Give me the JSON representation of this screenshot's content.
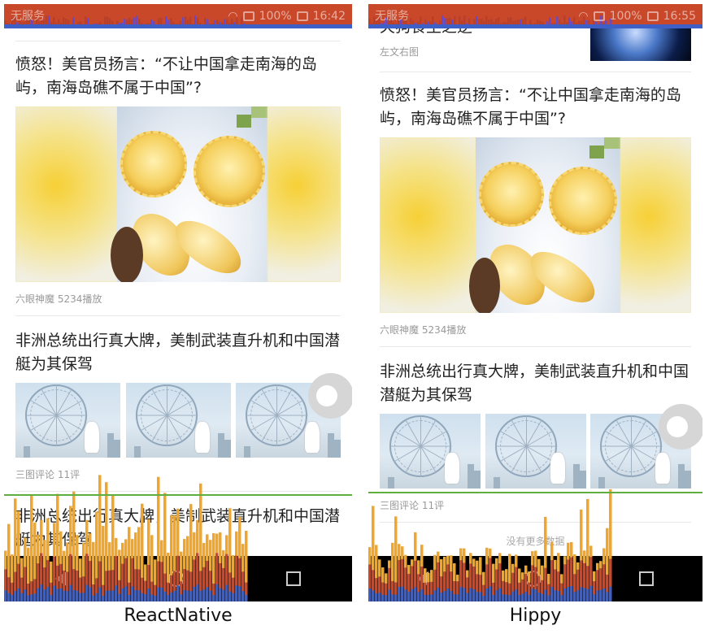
{
  "status_bar": {
    "react_native": {
      "carrier": "无服务",
      "battery": "100%",
      "time": "16:42"
    },
    "hippy": {
      "carrier": "无服务",
      "battery": "100%",
      "time": "16:55"
    }
  },
  "react_native": {
    "caption": "ReactNative",
    "items": [
      {
        "title": "愤怒！美官员扬言：“不让中国拿走南海的岛屿，南海岛礁不属于中国”?",
        "meta": "六眼神魔  5234播放"
      },
      {
        "title": "非洲总统出行真大牌，美制武装直升机和中国潜艇为其保驾",
        "meta": "三图评论 11评"
      },
      {
        "title": "非洲总统出行真大牌，美制武装直升机和中国潜艇为其保驾"
      }
    ]
  },
  "hippy": {
    "caption": "Hippy",
    "prev_meta": "左文右图",
    "prev_title_partial": "天狗食生之逆",
    "items": [
      {
        "title": "愤怒！美官员扬言：“不让中国拿走南海的岛屿，南海岛礁不属于中国”?",
        "meta": "六眼神魔  5234播放"
      },
      {
        "title": "非洲总统出行真大牌，美制武装直升机和中国潜艇为其保驾",
        "meta": "三图评论 11评"
      }
    ],
    "no_more": "没有更多数据"
  },
  "icons": [
    "wifi-icon",
    "battery-icon",
    "sim-icon",
    "back-icon",
    "home-icon",
    "recent-apps-icon"
  ],
  "colors": {
    "status_bar": "#c9482a",
    "perf_bar_orange": "#f0a62b",
    "perf_bar_red": "#c9482a",
    "perf_bar_blue": "#3d5fc6",
    "frame_line": "#5fae3f"
  }
}
